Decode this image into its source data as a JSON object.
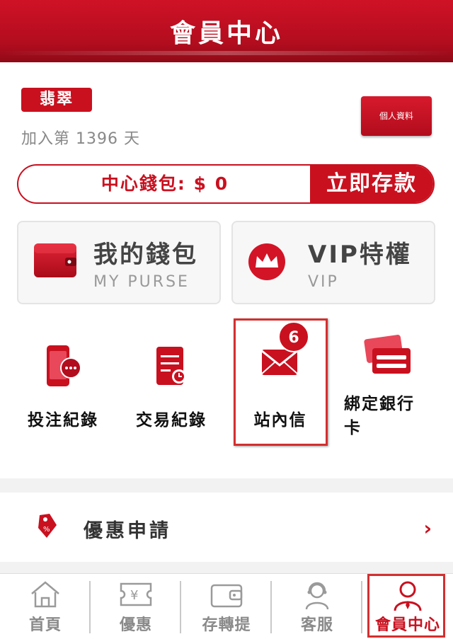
{
  "header": {
    "title": "會員中心"
  },
  "member": {
    "level": "翡翠",
    "join_text": "加入第 1396 天",
    "profile_button": "個人資料"
  },
  "wallet": {
    "label": "中心錢包: $ 0",
    "deposit_button": "立即存款"
  },
  "cards": [
    {
      "title": "我的錢包",
      "subtitle": "MY PURSE",
      "icon": "wallet-icon"
    },
    {
      "title": "VIP特權",
      "subtitle": "VIP",
      "icon": "crown-icon"
    }
  ],
  "shortcuts": [
    {
      "label": "投注紀錄",
      "icon": "phone-chat-icon"
    },
    {
      "label": "交易紀錄",
      "icon": "receipt-clock-icon"
    },
    {
      "label": "站內信",
      "icon": "envelope-icon",
      "badge": "6"
    },
    {
      "label": "綁定銀行卡",
      "icon": "bank-card-icon"
    }
  ],
  "promo": {
    "label": "優惠申請",
    "icon": "discount-tag-icon"
  },
  "nav": [
    {
      "label": "首頁",
      "icon": "home-icon"
    },
    {
      "label": "優惠",
      "icon": "coupon-yen-icon"
    },
    {
      "label": "存轉提",
      "icon": "wallet-outline-icon"
    },
    {
      "label": "客服",
      "icon": "headset-agent-icon"
    },
    {
      "label": "會員中心",
      "icon": "member-icon",
      "active": true
    }
  ],
  "colors": {
    "brand_red": "#c9101f",
    "highlight": "#d32f2f"
  }
}
